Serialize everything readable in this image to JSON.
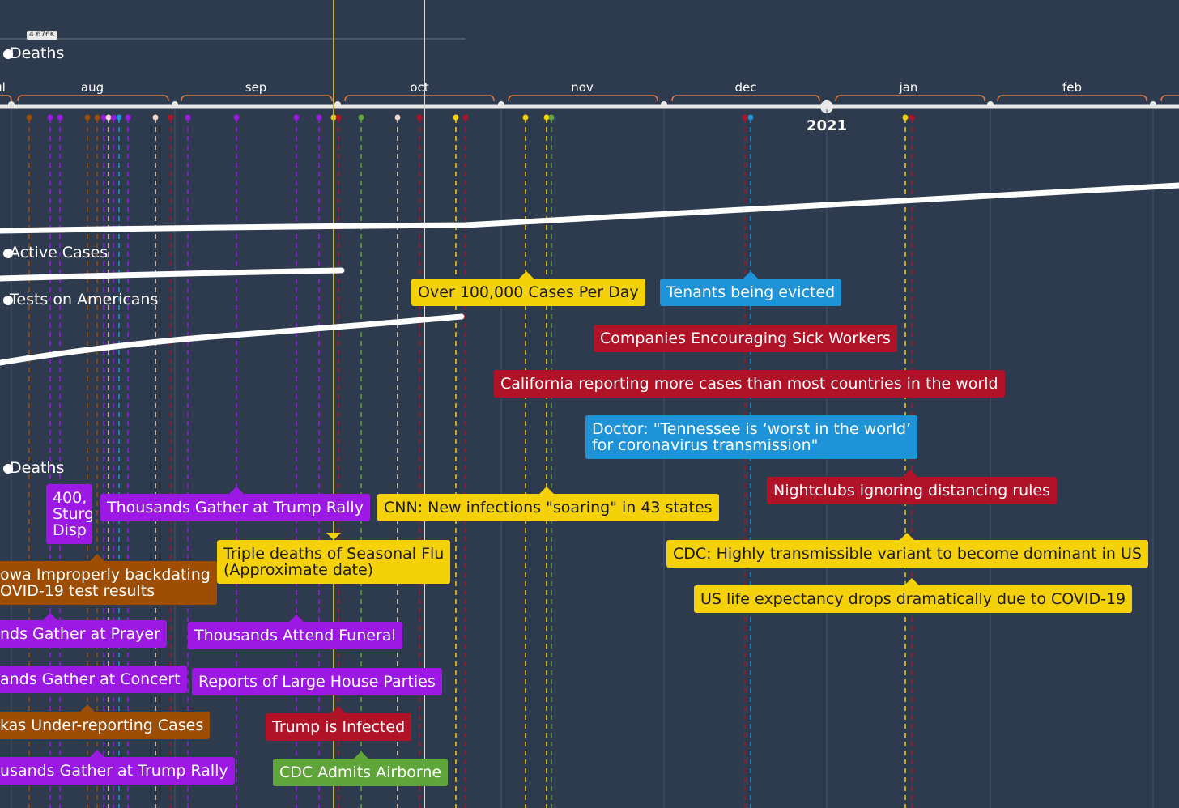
{
  "colors": {
    "background": "#2e3b4e",
    "yellow": "#f5d10a",
    "red": "#b01328",
    "blue": "#1e93d8",
    "purple": "#9b19e2",
    "orange": "#9e4d05",
    "green": "#5fa53a"
  },
  "header": {
    "count_badge": "4.676K",
    "top_label": "Deaths"
  },
  "timeline": {
    "months": [
      "ul",
      "aug",
      "sep",
      "oct",
      "nov",
      "dec",
      "jan",
      "feb"
    ],
    "year_label": "2021"
  },
  "series": {
    "active_cases": "Active Cases",
    "tests": "Tests on Americans",
    "deaths": "Deaths"
  },
  "events": [
    {
      "text": "Over 100,000 Cases Per Day",
      "color": "yellow"
    },
    {
      "text": "Tenants being evicted",
      "color": "blue"
    },
    {
      "text": "Companies Encouraging Sick Workers",
      "color": "red"
    },
    {
      "text": "California reporting more cases than most countries in the world",
      "color": "red"
    },
    {
      "text": "Doctor: \"Tennessee is ‘worst in the world’\nfor coronavirus transmission\"",
      "color": "blue"
    },
    {
      "text": "Nightclubs ignoring distancing rules",
      "color": "red"
    },
    {
      "text": "400,\nSturg\nDisp",
      "color": "purple"
    },
    {
      "text": "Thousands Gather at Trump Rally",
      "color": "purple"
    },
    {
      "text": "CNN: New infections \"soaring\" in 43 states",
      "color": "yellow"
    },
    {
      "text": "Triple deaths of Seasonal Flu\n(Approximate date)",
      "color": "yellow"
    },
    {
      "text": "CDC: Highly transmissible variant to become dominant in US",
      "color": "yellow"
    },
    {
      "text": "owa Improperly backdating\nOVID-19 test results",
      "color": "orange"
    },
    {
      "text": "US life expectancy drops dramatically due to COVID-19",
      "color": "yellow"
    },
    {
      "text": "nds Gather at Prayer",
      "color": "purple"
    },
    {
      "text": "Thousands Attend Funeral",
      "color": "purple"
    },
    {
      "text": "ands Gather at Concert",
      "color": "purple"
    },
    {
      "text": "Reports of Large House Parties",
      "color": "purple"
    },
    {
      "text": "kas Under-reporting Cases",
      "color": "orange"
    },
    {
      "text": "Trump is Infected",
      "color": "red"
    },
    {
      "text": "usands Gather at Trump Rally",
      "color": "purple"
    },
    {
      "text": "CDC Admits Airborne",
      "color": "green"
    }
  ]
}
